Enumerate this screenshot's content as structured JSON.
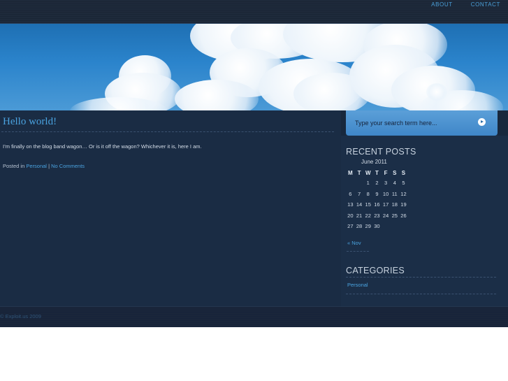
{
  "nav": {
    "items": [
      "ABOUT",
      "CONTACT"
    ]
  },
  "post": {
    "title": "Hello world!",
    "body": "I’m finally on the blog band wagon… Or is it off the wagon? Whichever it is, here I am.",
    "meta_prefix": "Posted in",
    "category": "Personal",
    "separator": "|",
    "comments": "No Comments"
  },
  "search": {
    "placeholder": "Type your search term here..."
  },
  "sidebar": {
    "recent_posts_title": "RECENT POSTS",
    "calendar": {
      "caption": "June 2011",
      "weekdays": [
        "M",
        "T",
        "W",
        "T",
        "F",
        "S",
        "S"
      ],
      "weeks": [
        [
          "",
          "",
          "1",
          "2",
          "3",
          "4",
          "5"
        ],
        [
          "6",
          "7",
          "8",
          "9",
          "10",
          "11",
          "12"
        ],
        [
          "13",
          "14",
          "15",
          "16",
          "17",
          "18",
          "19"
        ],
        [
          "20",
          "21",
          "22",
          "23",
          "24",
          "25",
          "26"
        ],
        [
          "27",
          "28",
          "29",
          "30",
          "",
          "",
          ""
        ]
      ],
      "prev": "« Nov"
    },
    "categories_title": "CATEGORIES",
    "categories": [
      "Personal"
    ]
  },
  "footer": {
    "copyright": "© Exploit.us 2009"
  }
}
